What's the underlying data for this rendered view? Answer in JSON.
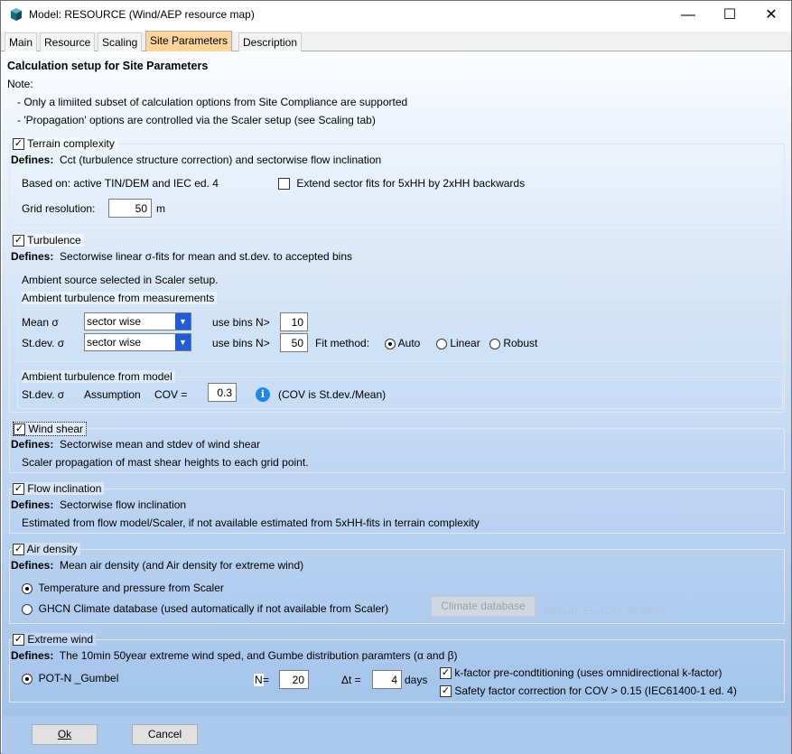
{
  "window": {
    "title": "Model: RESOURCE (Wind/AEP resource map)",
    "minimize": "—",
    "maximize": "☐",
    "close": "✕"
  },
  "tabs": [
    "Main",
    "Resource",
    "Scaling",
    "Site Parameters",
    "Description"
  ],
  "header": {
    "title": "Calculation setup for Site Parameters",
    "note_label": "Note:",
    "note_1": "- Only a limiited subset of calculation options from Site Compliance are supported",
    "note_2": "- 'Propagation' options are controlled via the Scaler setup (see Scaling tab)"
  },
  "terrain": {
    "label": "Terrain complexity",
    "checked": true,
    "defines_label": "Defines:",
    "defines": "Cct (turbulence structure correction) and sectorwise flow inclination",
    "based_on": "Based on:  active TIN/DEM  and  IEC ed. 4",
    "extend_label": "Extend sector fits for 5xHH by 2xHH backwards",
    "extend_checked": false,
    "grid_label": "Grid resolution:",
    "grid_value": "50",
    "grid_unit": "m"
  },
  "turbulence": {
    "label": "Turbulence",
    "checked": true,
    "defines_label": "Defines:",
    "defines": "Sectorwise linear σ-fits for mean and st.dev. to accepted bins",
    "ambient_source": "Ambient source selected in Scaler setup.",
    "meas_group": "Ambient turbulence from measurements",
    "mean_label": "Mean σ",
    "mean_select": "sector wise",
    "mean_bins_label": "use bins N>",
    "mean_bins": "10",
    "std_label": "St.dev. σ",
    "std_select": "sector wise",
    "std_bins_label": "use bins N>",
    "std_bins": "50",
    "fit_label": "Fit method:",
    "fit_options": [
      "Auto",
      "Linear",
      "Robust"
    ],
    "fit_selected": "Auto",
    "model_group": "Ambient turbulence from model",
    "model_std": "St.dev. σ",
    "assumption": "Assumption",
    "cov_label": "COV =",
    "cov_value": "0.3",
    "cov_note": "(COV is St.dev./Mean)"
  },
  "wind_shear": {
    "label": "Wind shear",
    "checked": true,
    "defines_label": "Defines:",
    "defines": "Sectorwise mean and stdev of wind shear",
    "detail": "Scaler propagation of mast shear heights to each grid point."
  },
  "flow": {
    "label": "Flow inclination",
    "checked": true,
    "defines_label": "Defines:",
    "defines": "Sectorwise flow inclination",
    "detail": "Estimated from flow model/Scaler, if not available estimated from 5xHH-fits in terrain complexity"
  },
  "air": {
    "label": "Air density",
    "checked": true,
    "defines_label": "Defines:",
    "defines": "Mean air density (and Air density for extreme wind)",
    "option_1": "Temperature and pressure from Scaler",
    "option_2": "GHCN Climate database (used automatically if not available from Scaler)",
    "selected": "option_1",
    "climate_button": "Climate database",
    "station": "Station: EL TOR V3 2014"
  },
  "extreme": {
    "label": "Extreme wind",
    "checked": true,
    "defines_label": "Defines:",
    "defines": "The 10min 50year extreme wind sped, and Gumbe distribution paramters (α and β)",
    "method": "POT-N _Gumbel",
    "n_label": "N",
    "n_eq": "=",
    "n_value": "20",
    "dt_label": "Δt =",
    "dt_value": "4",
    "dt_unit": "days",
    "kfactor": "k-factor pre-condtitioning (uses omnidirectional k-factor)",
    "kfactor_checked": true,
    "safety": "Safety factor correction for COV > 0.15 (IEC61400-1 ed. 4)",
    "safety_checked": true
  },
  "footer": {
    "ok": "Ok",
    "cancel": "Cancel"
  },
  "colors": {
    "active_tab": "#fbd59a",
    "info_icon": "#1e88e5",
    "select_arrow": "#1f5cd6"
  }
}
